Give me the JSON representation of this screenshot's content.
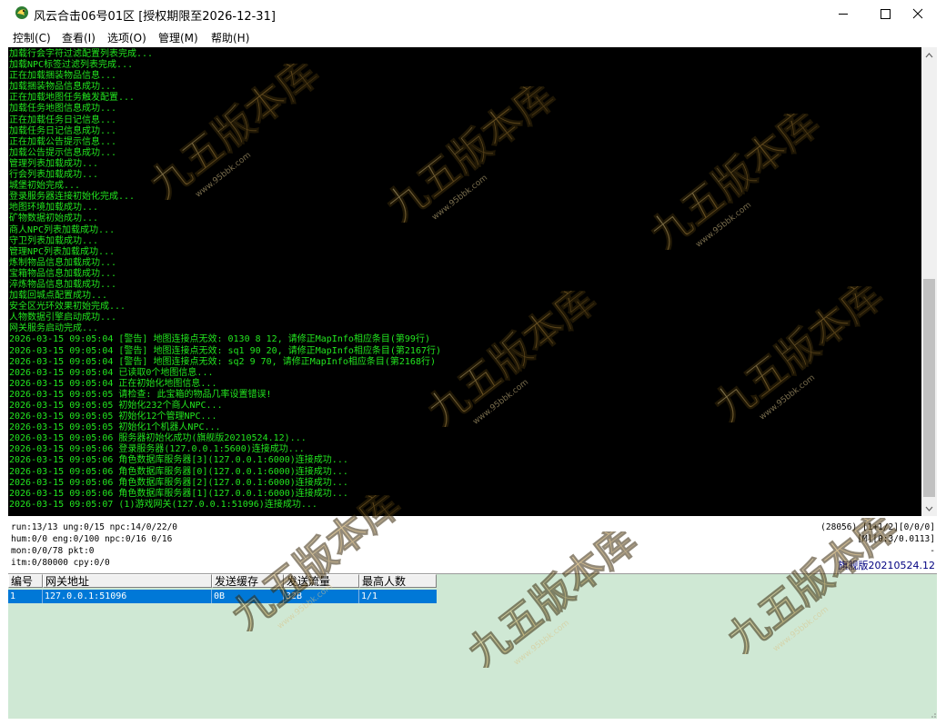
{
  "window": {
    "title": "风云合击06号01区 [授权期限至2026-12-31]",
    "controls": {
      "minimize": "minimize-icon",
      "maximize": "maximize-icon",
      "close": "close-icon"
    }
  },
  "menu": [
    {
      "label": "控制(C)"
    },
    {
      "label": "查看(I)"
    },
    {
      "label": "选项(O)"
    },
    {
      "label": "管理(M)"
    },
    {
      "label": "帮助(H)"
    }
  ],
  "console": {
    "text_color": "#22e61f",
    "background": "#000000",
    "lines": [
      "加载行会字符过滤配置列表完成...",
      "加载NPC标签过滤列表完成...",
      "正在加载捆装物品信息...",
      "加载捆装物品信息成功...",
      "正在加载地图任务触发配置...",
      "加载任务地图信息成功...",
      "正在加载任务日记信息...",
      "加载任务日记信息成功...",
      "正在加载公告提示信息...",
      "加载公告提示信息成功...",
      "管理列表加载成功...",
      "行会列表加载成功...",
      "城堡初始完成...",
      "登录服务器连接初始化完成...",
      "地图环境加载成功...",
      "矿物数据初始成功...",
      "商人NPC列表加载成功...",
      "守卫列表加载成功...",
      "管理NPC列表加载成功...",
      "炼制物品信息加载成功...",
      "宝箱物品信息加载成功...",
      "淬炼物品信息加载成功...",
      "加载回城点配置成功...",
      "安全区光环效果初始完成...",
      "人物数据引擎启动成功...",
      "网关服务启动完成...",
      "2026-03-15 09:05:04 [警告] 地图连接点无效: 0130 8 12, 请修正MapInfo相应条目(第99行)",
      "2026-03-15 09:05:04 [警告] 地图连接点无效: sq1 90 20, 请修正MapInfo相应条目(第2167行)",
      "2026-03-15 09:05:04 [警告] 地图连接点无效: sq2 9 70, 请修正MapInfo相应条目(第2168行)",
      "2026-03-15 09:05:04 已读取0个地图信息...",
      "2026-03-15 09:05:04 正在初始化地图信息...",
      "2026-03-15 09:05:05 请检查: 此宝箱的物品几率设置错误!",
      "2026-03-15 09:05:05 初始化232个商人NPC...",
      "2026-03-15 09:05:05 初始化12个管理NPC...",
      "2026-03-15 09:05:05 初始化1个机器人NPC...",
      "2026-03-15 09:05:06 服务器初始化成功(旗舰版20210524.12)...",
      "2026-03-15 09:05:06 登录服务器(127.0.0.1:5600)连接成功...",
      "2026-03-15 09:05:06 角色数据库服务器[3](127.0.0.1:6000)连接成功...",
      "2026-03-15 09:05:06 角色数据库服务器[0](127.0.0.1:6000)连接成功...",
      "2026-03-15 09:05:06 角色数据库服务器[2](127.0.0.1:6000)连接成功...",
      "2026-03-15 09:05:06 角色数据库服务器[1](127.0.0.1:6000)连接成功...",
      "2026-03-15 09:05:07 (1)游戏网关(127.0.0.1:51096)连接成功..."
    ]
  },
  "status": {
    "line1": "run:13/13 ung:0/15 npc:14/0/22/0",
    "line2": "hum:0/0 eng:0/100 npc:0/16 0/16",
    "line3": "mon:0/0/78 pkt:0",
    "line4": "itm:0/80000 cpy:0/0",
    "right1": "(28056) [1+1/2][0/0/0]",
    "right2": "[M][0:3/0.0113]",
    "right3": "-",
    "version": "旗舰版20210524.12",
    "version_color": "#000080"
  },
  "table": {
    "columns": [
      "编号",
      "网关地址",
      "发送缓存",
      "发送流量",
      "最高人数"
    ],
    "rows": [
      [
        "1",
        "127.0.0.1:51096",
        "0B",
        "32B",
        "1/1"
      ]
    ],
    "selected_color": "#0078d7",
    "background": "#cfe8d4"
  },
  "watermark": {
    "brand": "九五版本库",
    "url": "www.95bbk.com"
  }
}
